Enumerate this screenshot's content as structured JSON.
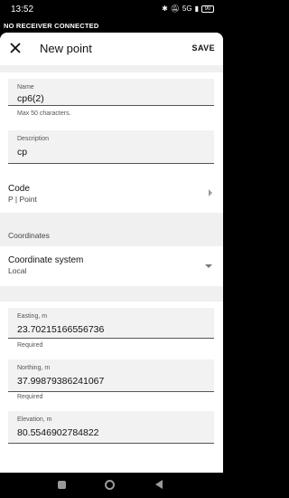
{
  "status_bar": {
    "time": "13:52",
    "network": "5G",
    "battery": "90"
  },
  "banner": {
    "text": "NO RECEIVER CONNECTED"
  },
  "appbar": {
    "title": "New point",
    "save_label": "SAVE"
  },
  "name_field": {
    "label": "Name",
    "value": "cp6(2)",
    "helper": "Max 50 characters."
  },
  "description_field": {
    "label": "Description",
    "value": "cp"
  },
  "code": {
    "label": "Code",
    "value": "P | Point"
  },
  "coordinates_section": {
    "label": "Coordinates"
  },
  "coordinate_system": {
    "label": "Coordinate system",
    "value": "Local"
  },
  "easting": {
    "label": "Easting, m",
    "value": "23.70215166556736",
    "helper": "Required"
  },
  "northing": {
    "label": "Northing, m",
    "value": "37.99879386241067",
    "helper": "Required"
  },
  "elevation": {
    "label": "Elevation, m",
    "value": "80.5546902784822"
  }
}
